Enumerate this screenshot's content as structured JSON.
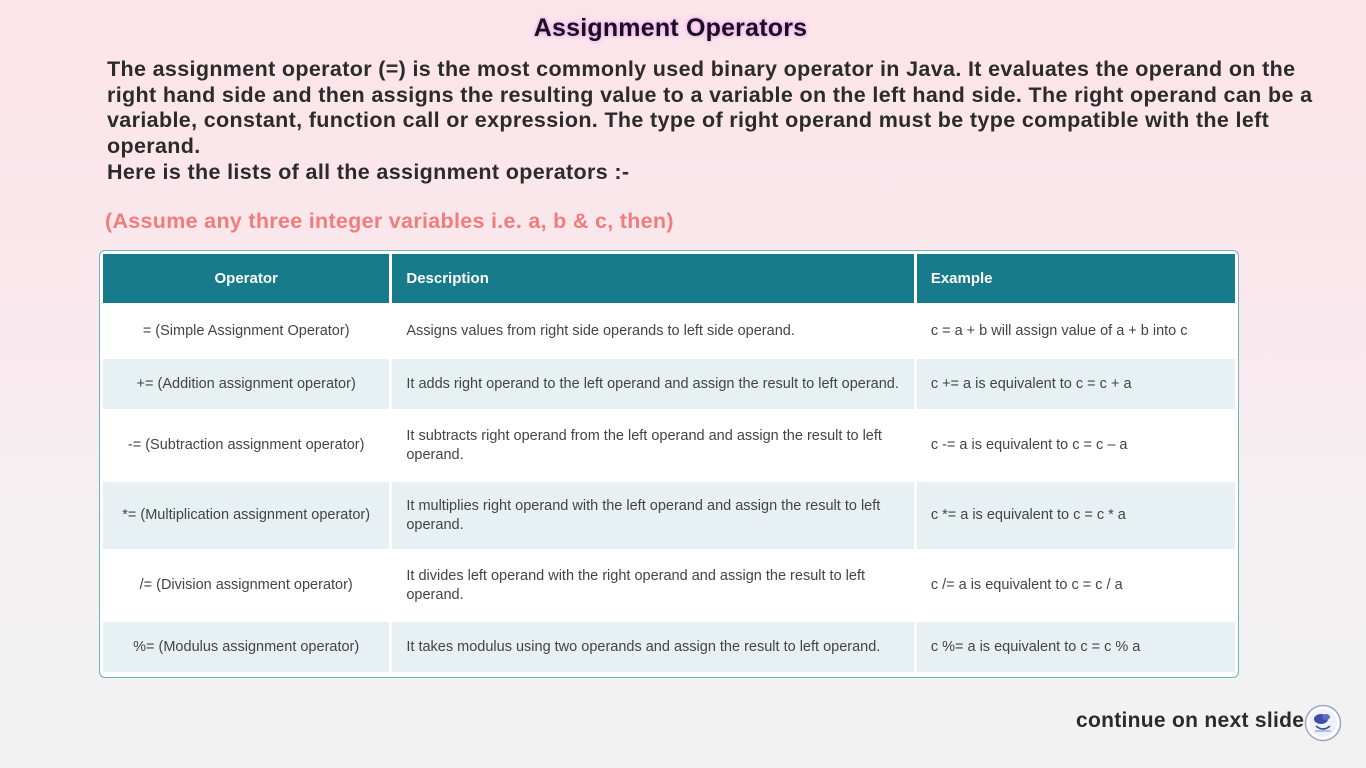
{
  "slide": {
    "title": "Assignment Operators",
    "intro": "The assignment operator (=) is the most commonly used binary operator in Java. It evaluates the operand on the right hand side and then assigns the resulting value to a variable on the left hand side. The right operand can be a variable, constant, function call or expression. The type of right operand must be type compatible with the left operand.",
    "list_heading": "Here is the lists of all the assignment operators :-",
    "assume_note": "(Assume any three integer variables i.e. a, b & c, then)",
    "footer": "continue on next slide.",
    "logo_icon": "presenter-logo-icon"
  },
  "colors": {
    "header_bg": "#177b8c",
    "note_text": "#f07c7c",
    "row_alt": "#e7f0f2"
  },
  "table": {
    "headers": [
      "Operator",
      "Description",
      "Example"
    ],
    "rows": [
      {
        "operator": "= (Simple Assignment Operator)",
        "description": "Assigns values from right side operands to left side operand.",
        "example": "c = a + b will assign value of a + b into c"
      },
      {
        "operator": "+= (Addition assignment operator)",
        "description": "It adds right operand to the left operand and assign the result to left operand.",
        "example": "c += a is equivalent to c = c + a"
      },
      {
        "operator": "-= (Subtraction assignment operator)",
        "description": "It subtracts right operand from the left operand and assign the result to left operand.",
        "example": "c -= a is equivalent to c = c – a"
      },
      {
        "operator": "*= (Multiplication assignment operator)",
        "description": "It multiplies right operand with the left operand and assign the result to left operand.",
        "example": "c *= a is equivalent to c = c * a"
      },
      {
        "operator": "/= (Division assignment operator)",
        "description": "It divides left operand with the right operand and assign the result to left operand.",
        "example": "c /= a is equivalent to c = c / a"
      },
      {
        "operator": "%= (Modulus assignment operator)",
        "description": "It takes modulus using two operands and assign the result to left operand.",
        "example": "c %= a is equivalent to c = c % a"
      }
    ]
  }
}
